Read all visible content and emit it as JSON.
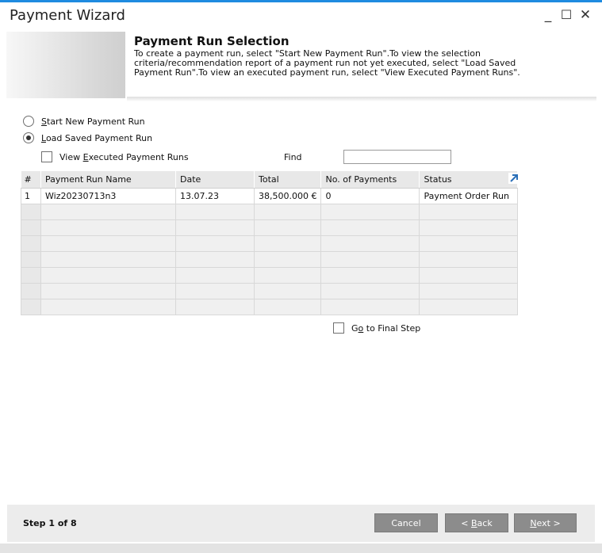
{
  "window": {
    "title": "Payment Wizard",
    "minimize_glyph": "_",
    "maximize_glyph": "☐",
    "close_glyph": "✕"
  },
  "banner": {
    "heading": "Payment Run Selection",
    "description_lines": [
      "To create a payment run, select \"Start New Payment Run\".To view the selection",
      "criteria/recommendation report of a payment run not yet executed, select \"Load Saved",
      "Payment Run\".To view an executed payment run, select \"View Executed Payment Runs\"."
    ]
  },
  "options": {
    "start_new": {
      "mnemonic": "S",
      "rest": "tart New Payment Run",
      "selected": false
    },
    "load_saved": {
      "mnemonic": "L",
      "rest": "oad Saved Payment Run",
      "selected": true
    },
    "view_executed": {
      "before": "View ",
      "mnemonic": "E",
      "rest": "xecuted Payment Runs",
      "checked": false
    }
  },
  "find": {
    "label": "Find",
    "value": ""
  },
  "table": {
    "columns": [
      "#",
      "Payment Run Name",
      "Date",
      "Total",
      "No. of Payments",
      "Status"
    ],
    "rows": [
      [
        "1",
        "Wiz20230713n3",
        "13.07.23",
        "€ 38,500.000",
        "0",
        "Payment Order Run"
      ],
      [
        "",
        "",
        "",
        "",
        "",
        ""
      ],
      [
        "",
        "",
        "",
        "",
        "",
        ""
      ],
      [
        "",
        "",
        "",
        "",
        "",
        ""
      ],
      [
        "",
        "",
        "",
        "",
        "",
        ""
      ],
      [
        "",
        "",
        "",
        "",
        "",
        ""
      ],
      [
        "",
        "",
        "",
        "",
        "",
        ""
      ],
      [
        "",
        "",
        "",
        "",
        "",
        ""
      ]
    ]
  },
  "go_final": {
    "before": "G",
    "mnemonic": "o",
    "rest": " to Final Step",
    "checked": false
  },
  "footer": {
    "step": "Step 1 of 8",
    "cancel": "Cancel",
    "back_prefix": "< ",
    "back_mnemonic": "B",
    "back_rest": "ack",
    "next_mnemonic": "N",
    "next_rest": "ext >"
  },
  "colors": {
    "accent": "#1f8be0",
    "button": "#8c8c8c",
    "header_bg": "#e8e8e8",
    "footer_bg": "#ececec"
  }
}
